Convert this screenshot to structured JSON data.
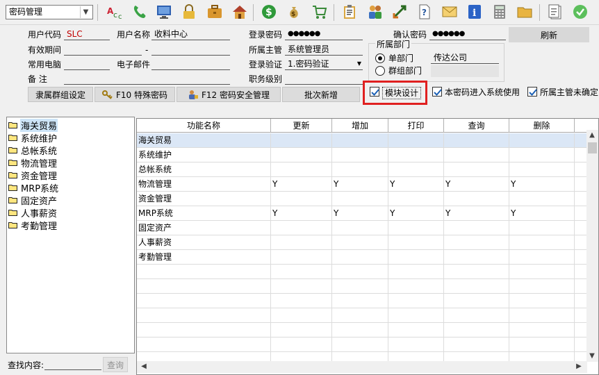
{
  "toolbar": {
    "module_select": "密码管理",
    "icons": [
      "text-abc-icon",
      "phone-icon",
      "monitor-icon",
      "lock-icon",
      "briefcase-icon",
      "home-icon",
      "dollar-icon",
      "money-bag-icon",
      "cart-icon",
      "clipboard-icon",
      "people-icon",
      "exchange-icon",
      "help-icon",
      "mail-icon",
      "info-icon",
      "calculator-icon",
      "folder-icon",
      "document-icon",
      "ok-icon"
    ]
  },
  "form": {
    "user_code_label": "用户代码",
    "user_code_value": "SLC",
    "user_name_label": "用户名称",
    "user_name_value": "收料中心",
    "login_pwd_label": "登录密码",
    "login_pwd_value": "●●●●●●",
    "confirm_pwd_label": "确认密码",
    "confirm_pwd_value": "●●●●●●",
    "refresh_label": "刷新",
    "valid_period_label": "有效期间",
    "valid_dash": "-",
    "supervisor_label": "所属主管",
    "supervisor_value": "系统管理员",
    "phone_label": "常用电脑",
    "email_label": "电子邮件",
    "verify_label": "登录验证",
    "verify_value": "1.密码验证",
    "note_label": "备    注",
    "job_level_label": "职务级别",
    "dept_group_title": "所属部门",
    "single_dept_label": "单部门",
    "single_dept_value": "传达公司",
    "group_dept_label": "群组部门",
    "group_setting_btn": "隶属群组设定",
    "f10_btn": "F10 特殊密码",
    "f12_btn": "F12 密码安全管理",
    "batch_add_btn": "批次新增",
    "module_design_label": "模块设计",
    "enter_system_label": "本密码进入系统使用",
    "supervisor_unconfirmed_label": "所属主管未确定"
  },
  "tree": {
    "items": [
      "海关贸易",
      "系统维护",
      "总帐系统",
      "物流管理",
      "资金管理",
      "MRP系统",
      "固定资产",
      "人事薪资",
      "考勤管理"
    ],
    "selected": "海关贸易"
  },
  "search": {
    "label": "查找内容:",
    "button": "查询"
  },
  "grid": {
    "columns": [
      "功能名称",
      "更新",
      "增加",
      "打印",
      "查询",
      "删除"
    ],
    "rows": [
      {
        "name": "海关贸易",
        "update": "",
        "add": "",
        "print": "",
        "query": "",
        "delete": ""
      },
      {
        "name": "系统维护",
        "update": "",
        "add": "",
        "print": "",
        "query": "",
        "delete": ""
      },
      {
        "name": "总帐系统",
        "update": "",
        "add": "",
        "print": "",
        "query": "",
        "delete": ""
      },
      {
        "name": "物流管理",
        "update": "Y",
        "add": "Y",
        "print": "Y",
        "query": "Y",
        "delete": "Y"
      },
      {
        "name": "资金管理",
        "update": "",
        "add": "",
        "print": "",
        "query": "",
        "delete": ""
      },
      {
        "name": "MRP系统",
        "update": "Y",
        "add": "Y",
        "print": "Y",
        "query": "Y",
        "delete": "Y"
      },
      {
        "name": "固定资产",
        "update": "",
        "add": "",
        "print": "",
        "query": "",
        "delete": ""
      },
      {
        "name": "人事薪资",
        "update": "",
        "add": "",
        "print": "",
        "query": "",
        "delete": ""
      },
      {
        "name": "考勤管理",
        "update": "",
        "add": "",
        "print": "",
        "query": "",
        "delete": ""
      }
    ]
  },
  "colors": {
    "accent_red": "#e02020",
    "selection_blue": "#dbe7f6",
    "user_code_red": "#c00000"
  }
}
